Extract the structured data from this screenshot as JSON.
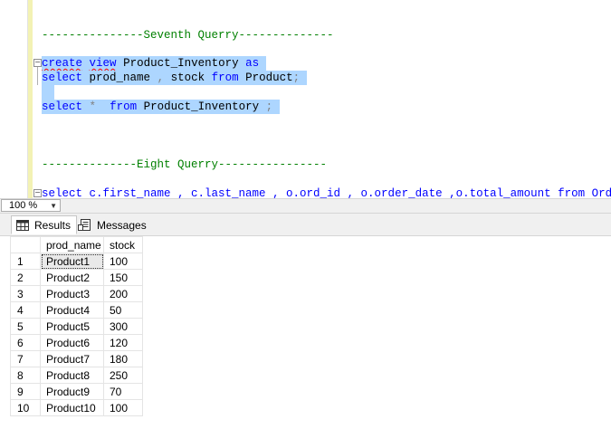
{
  "editor": {
    "comment7": "---------------Seventh Querry--------------",
    "line_create": {
      "kw1": "create",
      "kw2": "view",
      "name": "Product_Inventory",
      "kw3": "as"
    },
    "line_select1": {
      "kw1": "select",
      "cols1": "prod_name",
      "comma": ",",
      "cols2": "stock",
      "kw2": "from",
      "table": "Product",
      "semi": ";"
    },
    "line_select2": {
      "kw1": "select",
      "star": "*",
      "kw2": "from",
      "table": "Product_Inventory",
      "semi": ";"
    },
    "comment8": "--------------Eight Querry----------------",
    "line_select3": "select c.first_name , c.last_name , o.ord_id , o.order_date ,o.total_amount from Order_Sum"
  },
  "zoom": {
    "value": "100 %"
  },
  "tabs": {
    "results": "Results",
    "messages": "Messages"
  },
  "grid": {
    "headers": [
      "prod_name",
      "stock"
    ],
    "rows": [
      [
        "1",
        "Product1",
        "100"
      ],
      [
        "2",
        "Product2",
        "150"
      ],
      [
        "3",
        "Product3",
        "200"
      ],
      [
        "4",
        "Product4",
        "50"
      ],
      [
        "5",
        "Product5",
        "300"
      ],
      [
        "6",
        "Product6",
        "120"
      ],
      [
        "7",
        "Product7",
        "180"
      ],
      [
        "8",
        "Product8",
        "250"
      ],
      [
        "9",
        "Product9",
        "70"
      ],
      [
        "10",
        "Product10",
        "100"
      ]
    ]
  }
}
